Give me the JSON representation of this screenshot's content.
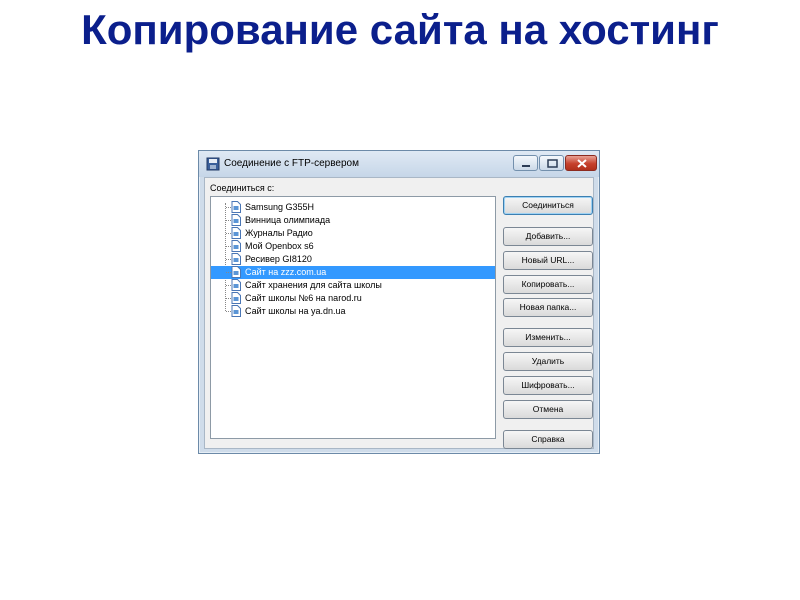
{
  "slide": {
    "title": "Копирование сайта на хостинг"
  },
  "window": {
    "title": "Соединение с FTP-сервером",
    "title_icon": "floppy-disk-icon",
    "controls": {
      "minimize_icon": "minimize-icon",
      "maximize_icon": "maximize-icon",
      "close_icon": "close-icon"
    }
  },
  "connect_label": "Соединиться с:",
  "tree": {
    "item_icon": "document-icon",
    "items": [
      {
        "label": "Samsung G355H"
      },
      {
        "label": "Винница олимпиада"
      },
      {
        "label": "Журналы Радио"
      },
      {
        "label": "Мой Openbox s6"
      },
      {
        "label": "Ресивер GI8120"
      },
      {
        "label": "Сайт на zzz.com.ua",
        "selected": true
      },
      {
        "label": "Сайт хранения для сайта школы"
      },
      {
        "label": "Сайт школы №6 на narod.ru"
      },
      {
        "label": "Сайт школы на ya.dn.ua"
      }
    ]
  },
  "buttons": {
    "connect": "Соединиться",
    "add": "Добавить...",
    "new_url": "Новый URL...",
    "copy": "Копировать...",
    "new_folder": "Новая папка...",
    "edit": "Изменить...",
    "delete": "Удалить",
    "encrypt": "Шифровать...",
    "cancel": "Отмена",
    "help": "Справка"
  },
  "colors": {
    "title": "#0b1f8c",
    "selection": "#3399ff",
    "close_button": "#c6412c"
  }
}
